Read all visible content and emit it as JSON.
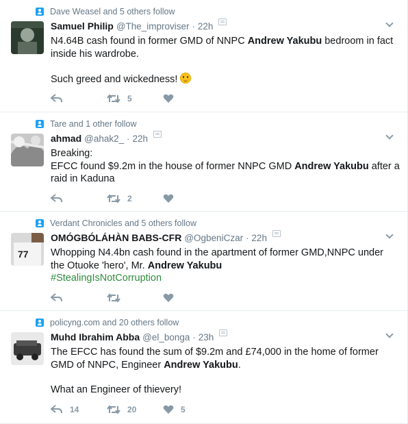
{
  "colors": {
    "secondary_text": "#657786",
    "icon": "#8899a6",
    "accent": "#1da1f2",
    "hashtag": "#2e8b3d",
    "divider": "#e6ecf0"
  },
  "tweets": [
    {
      "context": "Dave Weasel and 5 others follow",
      "fullname": "Samuel Philip",
      "username": "@The_improviser",
      "dot": "·",
      "time": "22h",
      "text": {
        "pre": "N4.64B cash found in former GMD of NNPC ",
        "bold": "Andrew Yakubu",
        "post": " bedroom in fact inside his wardrobe.",
        "extra": "Such greed and wickedness!"
      },
      "emoji": "slightly-smiling-face",
      "reply_count": "",
      "retweet_count": "5",
      "like_count": ""
    },
    {
      "context": "Tare and 1 other follow",
      "fullname": "ahmad",
      "username": "@ahak2_",
      "dot": "·",
      "time": "22h",
      "text": {
        "line1": "Breaking:",
        "pre": "EFCC found $9.2m in the house of former NNPC GMD ",
        "bold": "Andrew Yakubu",
        "post": " after a raid in Kaduna"
      },
      "reply_count": "",
      "retweet_count": "2",
      "like_count": ""
    },
    {
      "context": "Verdant Chronicles and 5 others follow",
      "fullname": "OMÓGBÓLÁHÀN BABS-CFR",
      "username": "@OgbeniCzar",
      "dot": "·",
      "time": "22h",
      "text": {
        "pre": "Whopping N4.4bn cash found in the apartment of former GMD,NNPC under the Otuoke 'hero', Mr. ",
        "bold": "Andrew Yakubu",
        "hashtag": "#StealingIsNotCorruption"
      },
      "reply_count": "",
      "retweet_count": "",
      "like_count": ""
    },
    {
      "context": "policyng.com and 20 others follow",
      "fullname": "Muhd Ibrahim Abba",
      "username": "@el_bonga",
      "dot": "·",
      "time": "23h",
      "text": {
        "pre": "The EFCC has found the sum of $9.2m and £74,000 in the home of former GMD of NNPC, Engineer ",
        "bold": "Andrew Yakubu",
        "post": ".",
        "extra": "What an Engineer of thievery!"
      },
      "reply_count": "14",
      "retweet_count": "20",
      "like_count": "5"
    }
  ]
}
